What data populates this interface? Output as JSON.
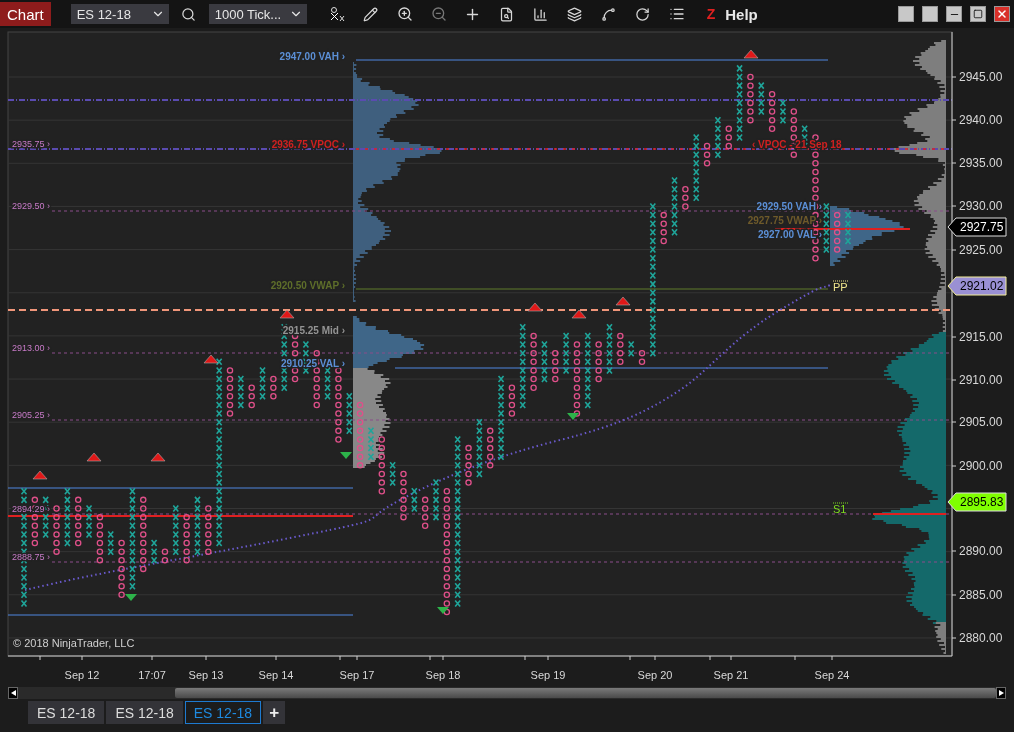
{
  "toolbar": {
    "title": "Chart",
    "instrument": "ES 12-18",
    "interval": "1000 Tick...",
    "z_label": "Z",
    "help": "Help"
  },
  "chart": {
    "price_axis": [
      "2945.00",
      "2940.00",
      "2935.00",
      "2930.00",
      "2925.00",
      "2915.00",
      "2910.00",
      "2905.00",
      "2900.00",
      "2890.00",
      "2885.00",
      "2880.00"
    ],
    "date_axis": [
      "Sep 12",
      "17:07",
      "Sep 13",
      "Sep 14",
      "Sep 17",
      "Sep 18",
      "Sep 19",
      "Sep 20",
      "Sep 21",
      "Sep 24"
    ],
    "level_labels": [
      "2935.75 ›",
      "2929.50 ›",
      "2913.00 ›",
      "2905.25 ›",
      "2894.29 ›",
      "2888.75 ›"
    ],
    "profile_labels": [
      {
        "text": "2947.00 VAH ›",
        "color": "#5b8fd6"
      },
      {
        "text": "2936.75 VPOC ›",
        "color": "#d02020"
      },
      {
        "text": "2920.50 VWAP ›",
        "color": "#5e6e2a"
      },
      {
        "text": "2915.25 Mid ›",
        "color": "#949494"
      },
      {
        "text": "2910.25 VAL ›",
        "color": "#5b8fd6"
      },
      {
        "text": "‹ VPOC - 21 Sep 18",
        "color": "#d02020"
      },
      {
        "text": "2929.50 VAH ›",
        "color": "#5b8fd6"
      },
      {
        "text": "2927.75 VWAP ›",
        "color": "#6e5a2a"
      },
      {
        "text": "2927.00 VAL ›",
        "color": "#5b8fd6"
      }
    ],
    "pivots": [
      {
        "text": "PP",
        "color": "#f0e68c"
      },
      {
        "text": "S1",
        "color": "#7ddc1f"
      }
    ],
    "price_tags": [
      {
        "text": "2927.75",
        "color": "#000000"
      },
      {
        "text": "2921.02",
        "color": "#9a90d4"
      },
      {
        "text": "2895.83",
        "color": "#7fff00"
      }
    ],
    "copyright": "© 2018 NinjaTrader, LLC"
  },
  "tabs": [
    {
      "label": "ES 12-18",
      "selected": false
    },
    {
      "label": "ES 12-18",
      "selected": false
    },
    {
      "label": "ES 12-18",
      "selected": true
    }
  ],
  "add_tab": "+"
}
